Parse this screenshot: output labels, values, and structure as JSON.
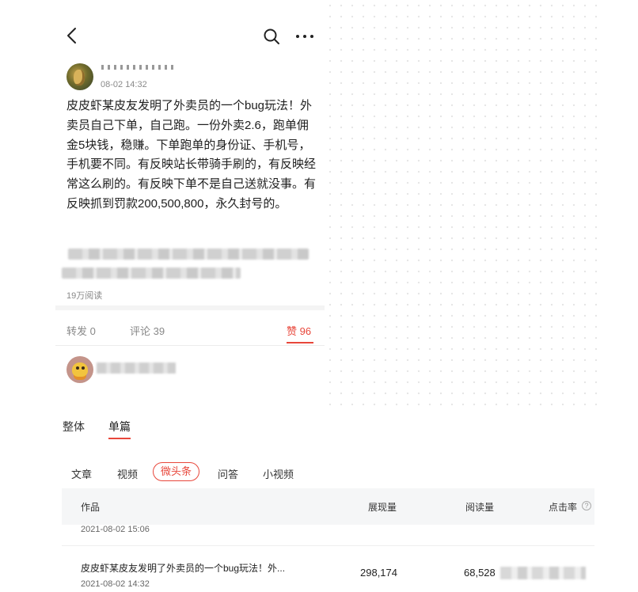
{
  "post": {
    "time": "08-02 14:32",
    "body": "皮皮虾某皮友发明了外卖员的一个bug玩法！外卖员自己下单，自己跑。一份外卖2.6，跑单佣金5块钱，稳赚。下单跑单的身份证、手机号，手机要不同。有反映站长带骑手刷的，有反映经常这么刷的。有反映下单不是自己送就没事。有反映抓到罚款200,500,800，永久封号的。",
    "read_count": "19万阅读"
  },
  "actions": {
    "repost": "转发 0",
    "comment": "评论 39",
    "like": "赞 96"
  },
  "panel": {
    "tabs": [
      "整体",
      "单篇"
    ],
    "sub_tabs": [
      "文章",
      "视频",
      "微头条",
      "问答",
      "小视频"
    ],
    "table": {
      "headers": [
        "作品",
        "展现量",
        "阅读量",
        "点击率"
      ],
      "help_icon": "?",
      "partial_row_date": "2021-08-02 15:06",
      "rows": [
        {
          "title": "皮皮虾某皮友发明了外卖员的一个bug玩法！外...",
          "date": "2021-08-02 14:32",
          "impressions": "298,174",
          "reads": "68,528"
        }
      ]
    }
  },
  "colors": {
    "accent": "#e8473b",
    "muted": "#888888",
    "header_bg": "#f5f6f7"
  }
}
